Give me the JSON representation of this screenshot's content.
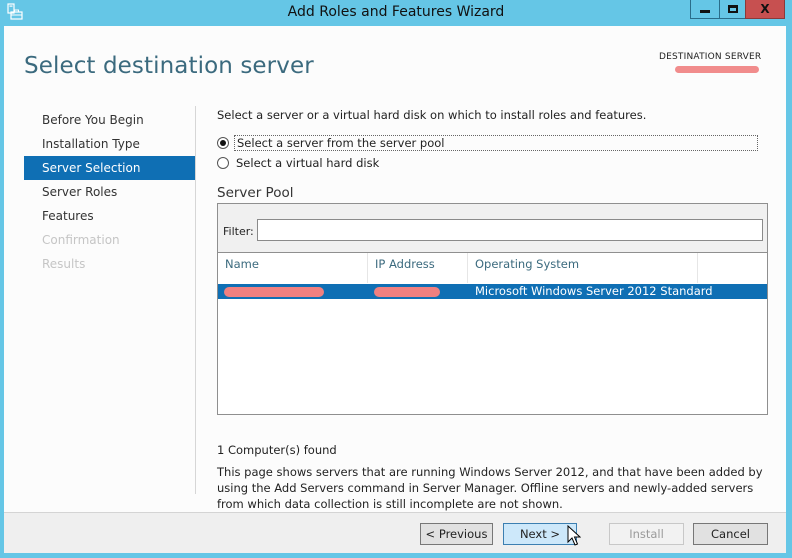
{
  "window": {
    "title": "Add Roles and Features Wizard",
    "icon": "server-manager-icon",
    "controls": {
      "minimize": "minimize",
      "maximize": "maximize",
      "close": "X"
    }
  },
  "header": {
    "page_title": "Select destination server",
    "destination_label": "DESTINATION SERVER",
    "destination_value_redacted": true
  },
  "nav": {
    "items": [
      {
        "label": "Before You Begin",
        "state": "normal"
      },
      {
        "label": "Installation Type",
        "state": "normal"
      },
      {
        "label": "Server Selection",
        "state": "active"
      },
      {
        "label": "Server Roles",
        "state": "normal"
      },
      {
        "label": "Features",
        "state": "normal"
      },
      {
        "label": "Confirmation",
        "state": "disabled"
      },
      {
        "label": "Results",
        "state": "disabled"
      }
    ]
  },
  "content": {
    "intro": "Select a server or a virtual hard disk on which to install roles and features.",
    "options": [
      {
        "label": "Select a server from the server pool",
        "selected": true
      },
      {
        "label": "Select a virtual hard disk",
        "selected": false
      }
    ],
    "pool": {
      "title": "Server Pool",
      "filter_label": "Filter:",
      "filter_value": "",
      "columns": [
        "Name",
        "IP Address",
        "Operating System"
      ],
      "rows": [
        {
          "name": "[redacted]",
          "ip": "[redacted]",
          "os": "Microsoft Windows Server 2012 Standard",
          "selected": true
        }
      ]
    },
    "found": "1 Computer(s) found",
    "description": "This page shows servers that are running Windows Server 2012, and that have been added by using the Add Servers command in Server Manager. Offline servers and newly-added servers from which data collection is still incomplete are not shown."
  },
  "footer": {
    "previous": "< Previous",
    "next": "Next >",
    "install": "Install",
    "cancel": "Cancel"
  },
  "colors": {
    "titlebar": "#65c6e6",
    "accent": "#0f6fb4",
    "close": "#c75050",
    "page_title": "#3b6a7e",
    "redaction": "#f08080"
  }
}
